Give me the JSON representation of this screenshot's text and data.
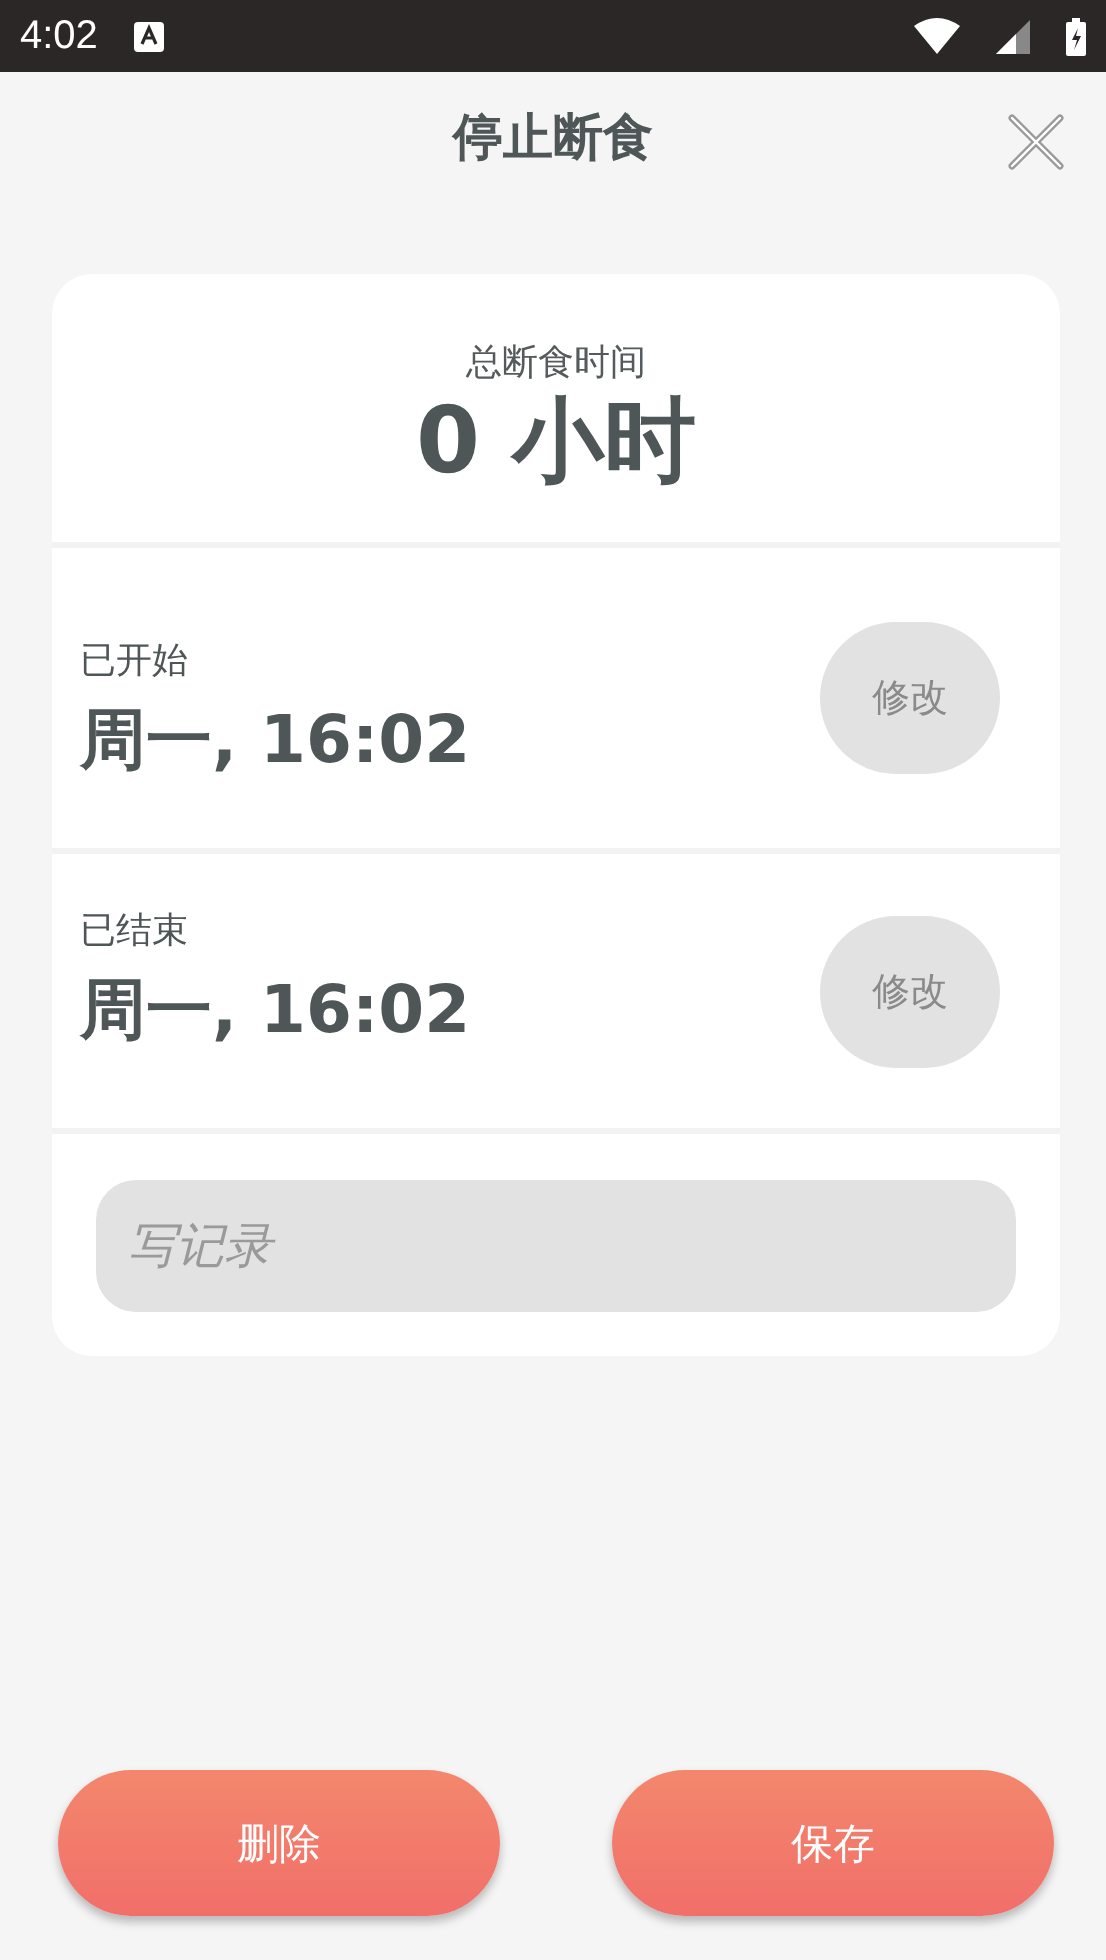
{
  "status_bar": {
    "time": "4:02"
  },
  "header": {
    "title": "停止断食"
  },
  "summary": {
    "label": "总断食时间",
    "value": "0 小时"
  },
  "times": [
    {
      "label": "已开始",
      "value": "周一, 16:02",
      "edit_button": {
        "label": "修改",
        "disabled": true
      }
    },
    {
      "label": "已结束",
      "value": "周一, 16:02",
      "edit_button": {
        "label": "修改",
        "disabled": true
      }
    }
  ],
  "notes": {
    "placeholder": "写记录"
  },
  "buttons": [
    {
      "label": "删除"
    },
    {
      "label": "保存"
    }
  ]
}
